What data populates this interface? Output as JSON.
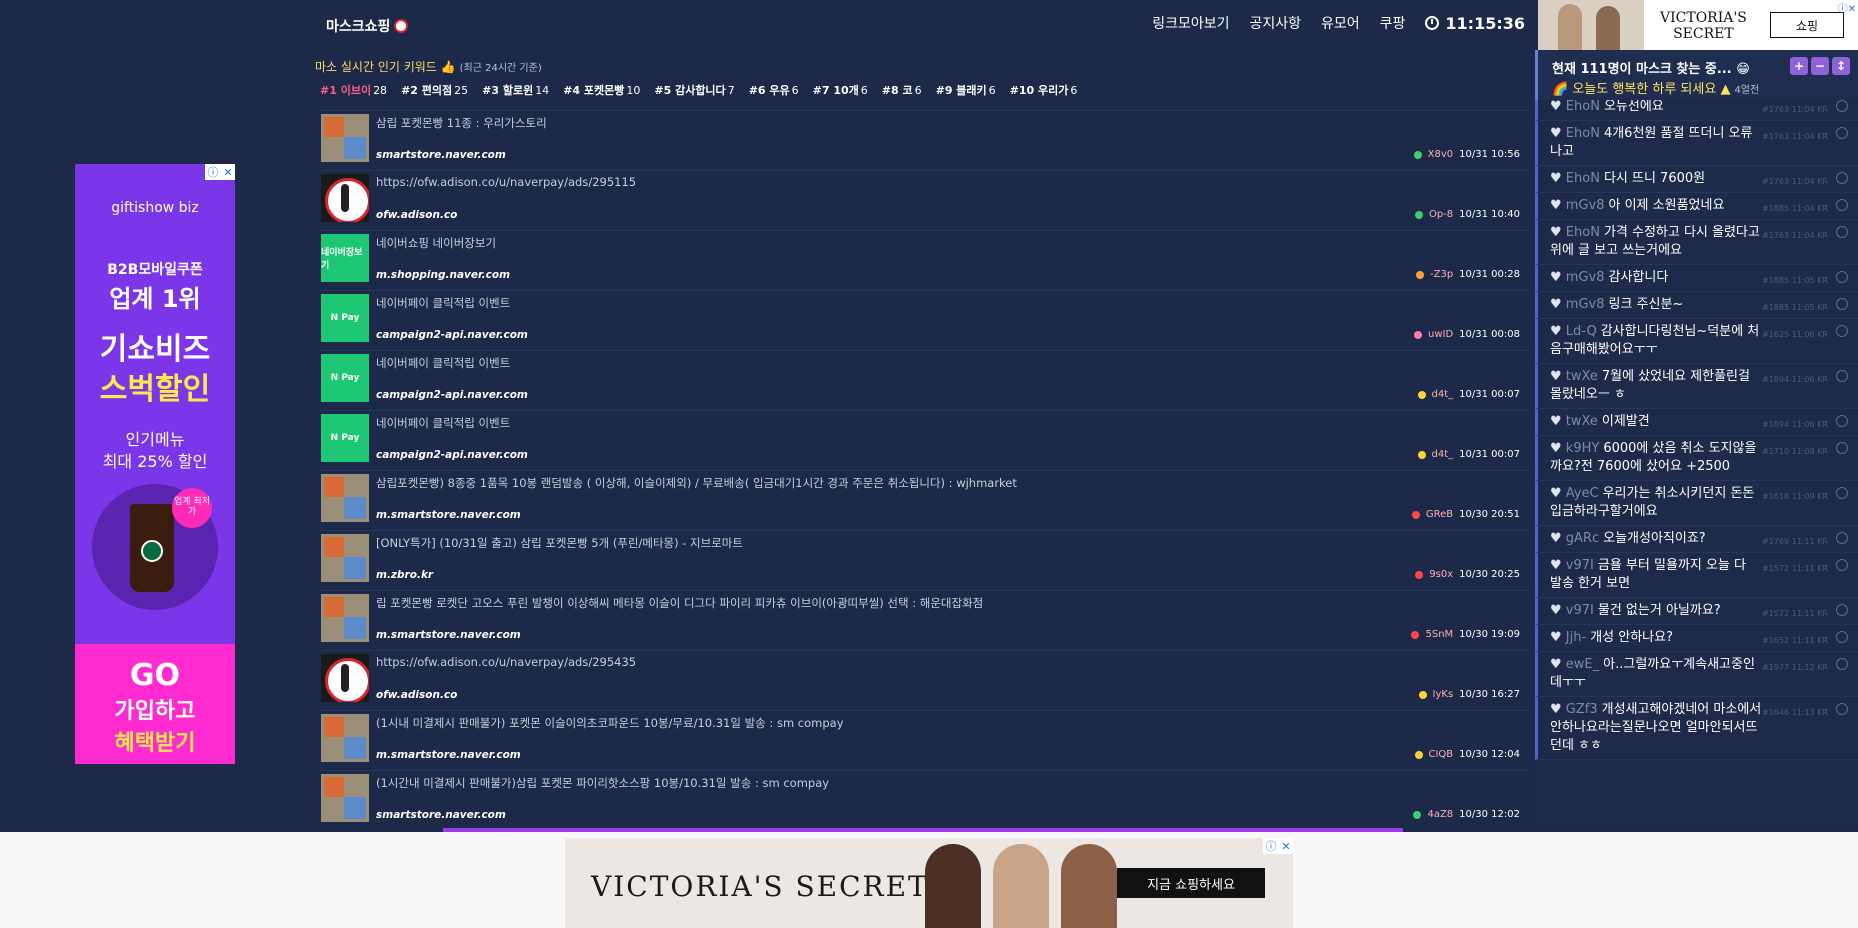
{
  "site": {
    "title": "마스크쇼핑",
    "logo_icon": "mask-logo-icon"
  },
  "nav": {
    "items": [
      "링크모아보기",
      "공지사항",
      "유모어",
      "쿠팡"
    ],
    "clock": "11:15:36"
  },
  "keywords": {
    "heading": "마소 실시간 인기 키워드",
    "heading_sub": "(최근 24시간 기준)",
    "items": [
      {
        "rank": "#1 이브이",
        "count": "28"
      },
      {
        "rank": "#2 편의점",
        "count": "25"
      },
      {
        "rank": "#3 할로윈",
        "count": "14"
      },
      {
        "rank": "#4 포켓몬빵",
        "count": "10"
      },
      {
        "rank": "#5 감사합니다",
        "count": "7"
      },
      {
        "rank": "#6 우유",
        "count": "6"
      },
      {
        "rank": "#7 10개",
        "count": "6"
      },
      {
        "rank": "#8 코",
        "count": "6"
      },
      {
        "rank": "#9 블래키",
        "count": "6"
      },
      {
        "rank": "#10 우리가",
        "count": "6"
      }
    ]
  },
  "links": [
    {
      "title": "삼립 포켓몬빵 11종 : 우리가스토리",
      "domain": "smartstore.naver.com",
      "user": "X8v0",
      "time": "10/31 10:56",
      "thumb": "p",
      "thumb_text": ""
    },
    {
      "title": "https://ofw.adison.co/u/naverpay/ads/295115",
      "domain": "ofw.adison.co",
      "user": "Op-8",
      "time": "10/31 10:40",
      "thumb": "k",
      "thumb_text": ""
    },
    {
      "title": "네이버쇼핑 네이버장보기",
      "domain": "m.shopping.naver.com",
      "user": "-Z3p",
      "time": "10/31 00:28",
      "thumb": "g",
      "thumb_text": "네이버장보기"
    },
    {
      "title": "네이버페이 클릭적립 이벤트",
      "domain": "campaign2-api.naver.com",
      "user": "uwID",
      "time": "10/31 00:08",
      "thumb": "g",
      "thumb_text": "N Pay"
    },
    {
      "title": "네이버페이 클릭적립 이벤트",
      "domain": "campaign2-api.naver.com",
      "user": "d4t_",
      "time": "10/31 00:07",
      "thumb": "g",
      "thumb_text": "N Pay"
    },
    {
      "title": "네이버페이 클릭적립 이벤트",
      "domain": "campaign2-api.naver.com",
      "user": "d4t_",
      "time": "10/31 00:07",
      "thumb": "g",
      "thumb_text": "N Pay"
    },
    {
      "title": "삼립포켓몬빵) 8종중 1품목 10봉 랜덤발송 ( 이상해, 이슬이제외) / 무료배송( 입금대기1시간 경과 주문은 취소됩니다) : wjhmarket",
      "domain": "m.smartstore.naver.com",
      "user": "GReB",
      "time": "10/30 20:51",
      "thumb": "p",
      "thumb_text": ""
    },
    {
      "title": "[ONLY특가] (10/31일 출고) 삼립 포켓몬빵 5개 (푸린/메타몽) - 지브로마트",
      "domain": "m.zbro.kr",
      "user": "9s0x",
      "time": "10/30 20:25",
      "thumb": "p",
      "thumb_text": ""
    },
    {
      "title": "립 포켓몬빵 로켓단 고오스 푸린 발챙이 이상해씨 메타몽 이슬이 디그다 파이리 피카츄 이브이(아광띠부씰) 선택 : 해운대잡화점",
      "domain": "m.smartstore.naver.com",
      "user": "5SnM",
      "time": "10/30 19:09",
      "thumb": "p",
      "thumb_text": ""
    },
    {
      "title": "https://ofw.adison.co/u/naverpay/ads/295435",
      "domain": "ofw.adison.co",
      "user": "IyKs",
      "time": "10/30 16:27",
      "thumb": "k",
      "thumb_text": ""
    },
    {
      "title": "(1시내 미결제시 판매불가) 포켓몬 이슬이의초코파운드 10봉/무료/10.31일 발송 : sm compay",
      "domain": "m.smartstore.naver.com",
      "user": "CIQB",
      "time": "10/30 12:04",
      "thumb": "p",
      "thumb_text": ""
    },
    {
      "title": "(1시간내 미결제시 판매불가)삼립 포켓몬 파이리핫소스팡 10봉/10.31일 발송 : sm compay",
      "domain": "smartstore.naver.com",
      "user": "4aZ8",
      "time": "10/30 12:02",
      "thumb": "p",
      "thumb_text": ""
    }
  ],
  "chat": {
    "count_text": "현재 111명이 마스크 찾는 중...",
    "motto": "오늘도 행복한 하루 되세요",
    "motto_who": "4얼전",
    "controls": [
      "+",
      "−",
      "↕"
    ],
    "messages": [
      {
        "nick": "EhoN",
        "text": "오뉴선에요",
        "id": "#1763",
        "time": "11:04",
        "cc": "KR"
      },
      {
        "nick": "EhoN",
        "text": "4개6천원 품절 뜨더니 오류나고",
        "id": "#1763",
        "time": "11:04",
        "cc": "KR"
      },
      {
        "nick": "EhoN",
        "text": "다시 뜨니 7600원",
        "id": "#1763",
        "time": "11:04",
        "cc": "KR"
      },
      {
        "nick": "mGv8",
        "text": "아 이제 소원품었네요",
        "id": "#1885",
        "time": "11:04",
        "cc": "KR"
      },
      {
        "nick": "EhoN",
        "text": "가격 수정하고 다시 올렸다고 위에 글 보고 쓰는거에요",
        "id": "#1763",
        "time": "11:04",
        "cc": "KR"
      },
      {
        "nick": "mGv8",
        "text": "감사합니다",
        "id": "#1885",
        "time": "11:05",
        "cc": "KR"
      },
      {
        "nick": "mGv8",
        "text": "링크 주신분~",
        "id": "#1885",
        "time": "11:05",
        "cc": "KR"
      },
      {
        "nick": "Ld-Q",
        "text": "감사합니다링천님~덕분에 처음구매해봤어요ㅜㅜ",
        "id": "#1625",
        "time": "11:06",
        "cc": "KR"
      },
      {
        "nick": "twXe",
        "text": "7월에 샀었네요 제한풀린걸 몰랐네오ㅡ ㅎ",
        "id": "#1894",
        "time": "11:06",
        "cc": "KR"
      },
      {
        "nick": "twXe",
        "text": "이제발견",
        "id": "#1894",
        "time": "11:06",
        "cc": "KR"
      },
      {
        "nick": "k9HY",
        "text": "6000에 샀음 취소 도지않을까요?전 7600에 샀어요 +2500",
        "id": "#1710",
        "time": "11:08",
        "cc": "KR"
      },
      {
        "nick": "AyeC",
        "text": "우리가는 취소시키던지 돈돈입금하라구할거에요",
        "id": "#1618",
        "time": "11:09",
        "cc": "KR"
      },
      {
        "nick": "gARc",
        "text": "오늘개성아직이죠?",
        "id": "#1769",
        "time": "11:11",
        "cc": "KR"
      },
      {
        "nick": "v97I",
        "text": "금욜 부터 밀욜까지 오늘 다 발송 한거 보면",
        "id": "#1572",
        "time": "11:11",
        "cc": "KR"
      },
      {
        "nick": "v97I",
        "text": "물건 없는거 아닐까요?",
        "id": "#1572",
        "time": "11:11",
        "cc": "KR"
      },
      {
        "nick": "Jjh-",
        "text": "개성 안하나요?",
        "id": "#1652",
        "time": "11:11",
        "cc": "KR"
      },
      {
        "nick": "ewE_",
        "text": "아..그럴까요ㅜ계속새고중인데ㅜㅜ",
        "id": "#1977",
        "time": "11:12",
        "cc": "KR"
      },
      {
        "nick": "GZf3",
        "text": "개성새고해야겠네어 마소에서 안하나요라는질문나오면 얼마안되서뜨던데 ㅎㅎ",
        "id": "#1646",
        "time": "11:13",
        "cc": "KR"
      }
    ]
  },
  "ads": {
    "left": {
      "brand": "giftishow biz",
      "line1": "B2B모바일쿠폰",
      "line2": "업계 1위",
      "line3": "기쇼비즈",
      "line4": "스벅할인",
      "line5": "인기메뉴",
      "line6": "최대 25% 할인",
      "tag": "업계 최저가",
      "cta1": "GO",
      "cta2": "가입하고",
      "cta3": "혜택받기"
    },
    "top_right": {
      "brand1": "VICTORIA'S",
      "brand2": "SECRET",
      "button": "쇼핑"
    },
    "bottom": {
      "brand": "VICTORIA'S SECRET",
      "button": "지금 쇼핑하세요"
    }
  },
  "colors": {
    "bg": "#1c2948",
    "accent": "#6a7dd8",
    "keyword_first": "#ff5e8a"
  }
}
